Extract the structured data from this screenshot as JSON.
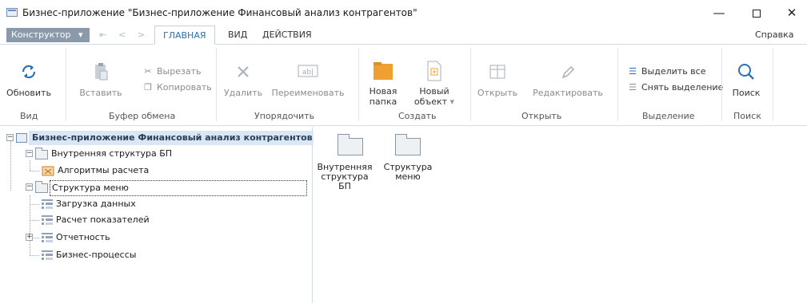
{
  "window": {
    "title": "Бизнес-приложение \"Бизнес-приложение Финансовый анализ контрагентов\"",
    "minimize": "—",
    "close": "✕"
  },
  "tabsrow": {
    "constructor_label": "Конструктор",
    "constructor_arrow": "▾",
    "qa_undo": "⇤",
    "qa_back": "<",
    "qa_forward": ">",
    "tabs": [
      {
        "label": "ГЛАВНАЯ",
        "active": true
      },
      {
        "label": "ВИД",
        "active": false
      },
      {
        "label": "ДЕЙСТВИЯ",
        "active": false
      }
    ],
    "help_label": "Справка"
  },
  "ribbon": {
    "groups": [
      {
        "label": "Вид"
      },
      {
        "label": "Буфер обмена"
      },
      {
        "label": "Упорядочить"
      },
      {
        "label": "Создать"
      },
      {
        "label": "Открыть"
      },
      {
        "label": "Выделение"
      },
      {
        "label": "Поиск"
      }
    ],
    "buttons": {
      "refresh": "Обновить",
      "paste": "Вставить",
      "cut": "Вырезать",
      "copy": "Копировать",
      "delete": "Удалить",
      "rename": "Переименовать",
      "new_folder_1": "Новая",
      "new_folder_2": "папка",
      "new_object_1": "Новый",
      "new_object_2": "объект",
      "new_object_arrow": "▾",
      "open": "Открыть",
      "edit": "Редактировать",
      "select_all": "Выделить все",
      "deselect": "Снять выделение",
      "search": "Поиск"
    },
    "colors": {
      "accent_blue": "#2b72b5",
      "folder_orange": "#f0a030"
    }
  },
  "tree": {
    "root": "Бизнес-приложение Финансовый анализ контрагентов",
    "items": [
      {
        "label": "Внутренняя структура БП",
        "type": "folder",
        "expander": "−"
      },
      {
        "label": "Алгоритмы расчета",
        "type": "algorithm"
      },
      {
        "label": "Структура меню",
        "type": "folder",
        "expander": "−"
      },
      {
        "label": "Загрузка данных",
        "type": "doc"
      },
      {
        "label": "Расчет показателей",
        "type": "doc"
      },
      {
        "label": "Отчетность",
        "type": "doc",
        "expander": "+"
      },
      {
        "label": "Бизнес-процессы",
        "type": "doc"
      }
    ],
    "root_expander": "−"
  },
  "list": {
    "items": [
      {
        "line1": "Внутренняя",
        "line2": "структура БП"
      },
      {
        "line1": "Структура",
        "line2": "меню"
      }
    ]
  }
}
